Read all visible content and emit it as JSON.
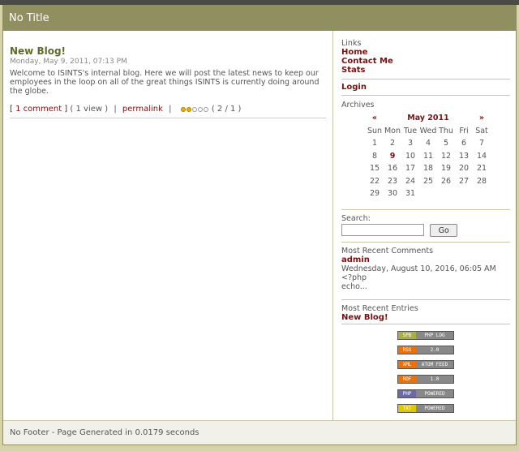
{
  "header": {
    "title": "No Title"
  },
  "post": {
    "title": "New Blog!",
    "date": "Monday, May 9, 2011, 07:13 PM",
    "body": "Welcome to ISINTS's internal blog. Here we will post the latest news to keep our employees in the loop on all of the great things ISINTS is currently doing around the globe.",
    "comments_link": "[ 1 comment ]",
    "views": "( 1 view )",
    "pipe": "|",
    "permalink": "permalink",
    "rating_value": 2,
    "rating_max": 5,
    "rating_text": "( 2 / 1 )"
  },
  "sidebar": {
    "links_head": "Links",
    "links": [
      "Home",
      "Contact Me",
      "Stats"
    ],
    "login": "Login",
    "archives_head": "Archives",
    "calendar": {
      "prev": "«",
      "next": "»",
      "month": "May 2011",
      "days": [
        "Sun",
        "Mon",
        "Tue",
        "Wed",
        "Thu",
        "Fri",
        "Sat"
      ],
      "weeks": [
        [
          "1",
          "2",
          "3",
          "4",
          "5",
          "6",
          "7"
        ],
        [
          "8",
          "9",
          "10",
          "11",
          "12",
          "13",
          "14"
        ],
        [
          "15",
          "16",
          "17",
          "18",
          "19",
          "20",
          "21"
        ],
        [
          "22",
          "23",
          "24",
          "25",
          "26",
          "27",
          "28"
        ],
        [
          "29",
          "30",
          "31",
          "",
          "",
          "",
          ""
        ]
      ],
      "highlight": "9"
    },
    "search_head": "Search:",
    "search_value": "",
    "search_button": "Go",
    "comments_head": "Most Recent Comments",
    "comment_author": "admin",
    "comment_date": "Wednesday, August 10, 2016, 06:05 AM",
    "comment_line1": "<?php",
    "comment_line2": "echo...",
    "entries_head": "Most Recent Entries",
    "entry_link": "New Blog!",
    "badges": [
      {
        "left": "SPB",
        "right": "PHP LOG",
        "color": "#a8b040"
      },
      {
        "left": "RSS",
        "right": "2.0",
        "color": "#f07000"
      },
      {
        "left": "XML",
        "right": "ATOM FEED",
        "color": "#f07000"
      },
      {
        "left": "RDF",
        "right": "1.0",
        "color": "#f07000"
      },
      {
        "left": "PHP",
        "right": "POWERED",
        "color": "#6a6aa8"
      },
      {
        "left": "TXT",
        "right": "POWERED",
        "color": "#e0c800"
      }
    ]
  },
  "footer": {
    "text": "No Footer - Page Generated in 0.0179 seconds"
  }
}
